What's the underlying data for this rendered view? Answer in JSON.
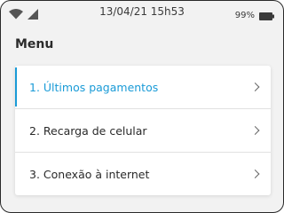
{
  "status_bar": {
    "time": "13/04/21 15h53",
    "battery": "99%",
    "icons": [
      "wifi-icon",
      "signal-icon",
      "battery-icon"
    ]
  },
  "page": {
    "title": "Menu"
  },
  "menu": {
    "items": [
      {
        "label": "1. Últimos pagamentos",
        "active": true
      },
      {
        "label": "2. Recarga de celular",
        "active": false
      },
      {
        "label": "3. Conexão à internet",
        "active": false
      }
    ]
  },
  "colors": {
    "accent": "#1a9bd7",
    "background": "#f2f2f2",
    "card": "#ffffff",
    "text": "#2a2a2a"
  }
}
